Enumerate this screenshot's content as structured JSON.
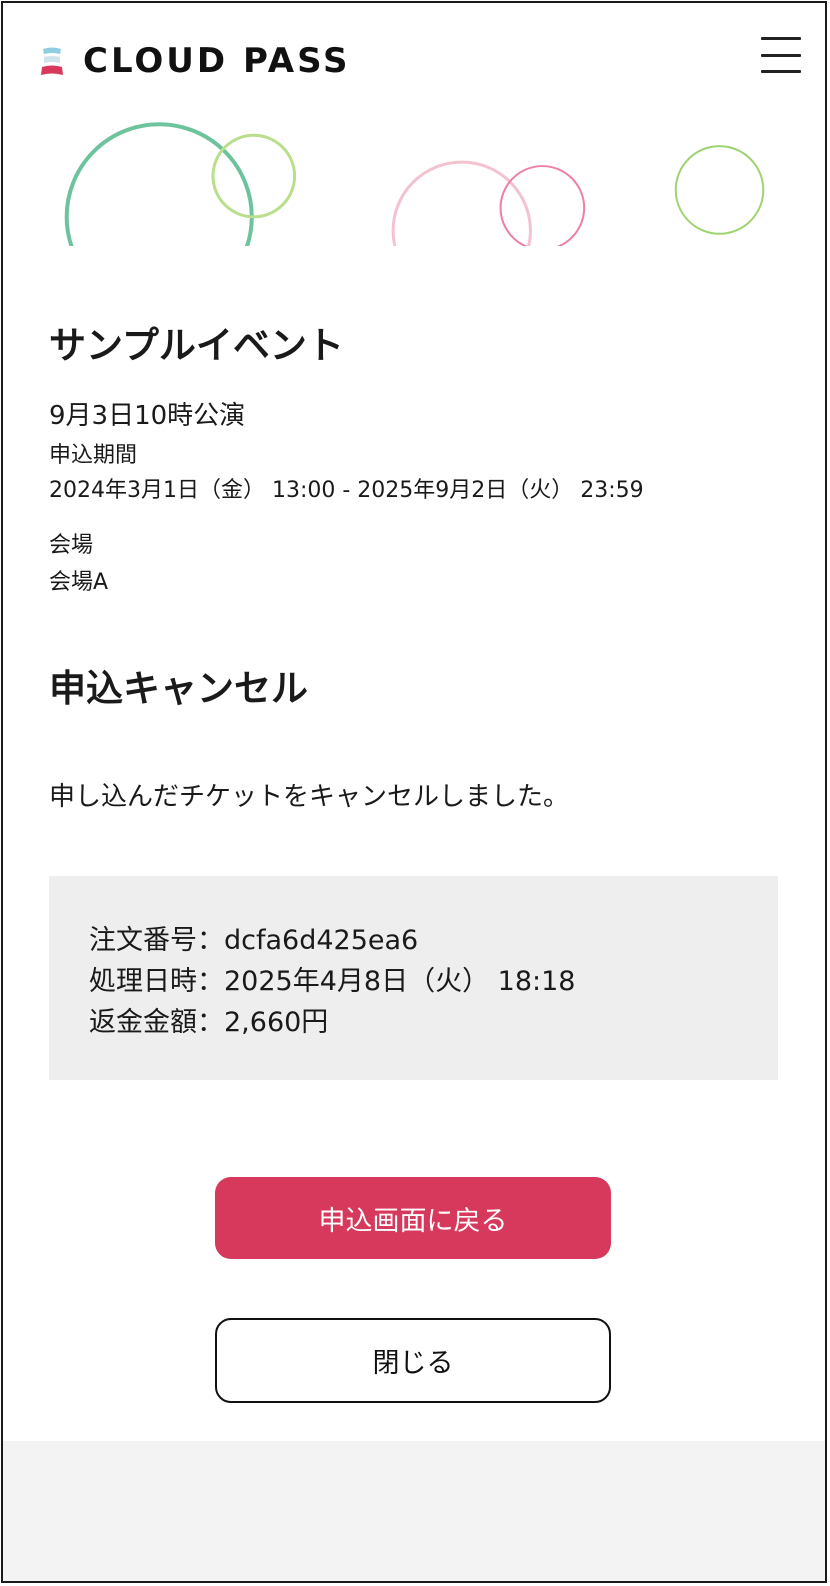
{
  "header": {
    "logo_text": "CLOUD PASS",
    "menu_icon": "hamburger-menu-icon"
  },
  "event": {
    "title": "サンプルイベント",
    "performance": "9月3日10時公演",
    "period_label": "申込期間",
    "period_value": "2024年3月1日（金） 13:00 - 2025年9月2日（火） 23:59",
    "venue_label": "会場",
    "venue_value": "会場A"
  },
  "cancel": {
    "section_title": "申込キャンセル",
    "message": "申し込んだチケットをキャンセルしました。",
    "order_number": "注文番号：dcfa6d425ea6",
    "processed_at": "処理日時：2025年4月8日（火） 18:18",
    "refund_amount": "返金金額：2,660円"
  },
  "buttons": {
    "back_label": "申込画面に戻る",
    "close_label": "閉じる"
  },
  "colors": {
    "accent": "#d6395b",
    "info_box_bg": "#eeeeee",
    "footer_bg": "#f3f3f3",
    "circle_teal": "#6cc39c",
    "circle_lime": "#b9df8c",
    "circle_light_pink": "#f2c2cf",
    "circle_pink": "#ee7fa3",
    "circle_green": "#9ed36f"
  }
}
